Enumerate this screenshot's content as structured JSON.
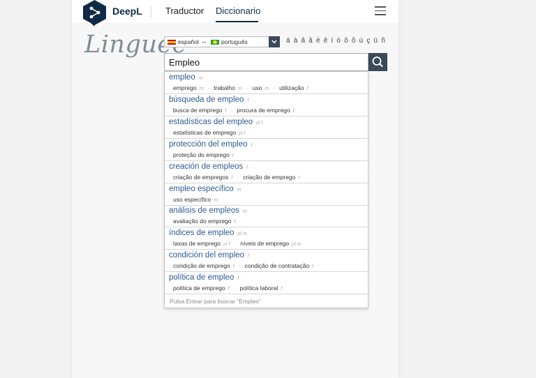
{
  "header": {
    "brand": "DeepL",
    "nav": [
      {
        "label": "Traductor"
      },
      {
        "label": "Diccionario"
      }
    ]
  },
  "linguee_logo": "Linguee",
  "language_selector": {
    "source": "español",
    "target": "português",
    "arrow": "↔"
  },
  "accent_chars": "á à ã â é ê í ó õ ô ú ç ü ñ",
  "search": {
    "value": "Empleo"
  },
  "suggestions": [
    {
      "term": "empleo",
      "gender": "m",
      "translations": [
        {
          "text": "emprego",
          "g": "m"
        },
        {
          "text": "trabalho",
          "g": "m"
        },
        {
          "text": "uso",
          "g": "m"
        },
        {
          "text": "utilização",
          "g": "f"
        }
      ]
    },
    {
      "term": "búsqueda de empleo",
      "gender": "f",
      "translations": [
        {
          "text": "busca de emprego",
          "g": "f"
        },
        {
          "text": "procura de emprego",
          "g": "f"
        }
      ]
    },
    {
      "term": "estadísticas del empleo",
      "gender": "pl f",
      "translations": [
        {
          "text": "estatísticas de emprego",
          "g": "pl f"
        }
      ]
    },
    {
      "term": "protección del empleo",
      "gender": "f",
      "translations": [
        {
          "text": "proteção do emprego",
          "g": "f"
        }
      ]
    },
    {
      "term": "creación de empleos",
      "gender": "f",
      "translations": [
        {
          "text": "criação de empregos",
          "g": "f"
        },
        {
          "text": "criação de emprego",
          "g": "f"
        }
      ]
    },
    {
      "term": "empleo específico",
      "gender": "m",
      "translations": [
        {
          "text": "uso específico",
          "g": "m"
        }
      ]
    },
    {
      "term": "análisis de empleos",
      "gender": "m",
      "translations": [
        {
          "text": "avaliação do emprego",
          "g": "f"
        }
      ]
    },
    {
      "term": "índices de empleo",
      "gender": "pl m",
      "translations": [
        {
          "text": "taxas de emprego",
          "g": "pl f"
        },
        {
          "text": "níveis de emprego",
          "g": "pl m"
        }
      ]
    },
    {
      "term": "condición del empleo",
      "gender": "f",
      "translations": [
        {
          "text": "condição de emprego",
          "g": "f"
        },
        {
          "text": "condição de contratação",
          "g": "f"
        }
      ]
    },
    {
      "term": "política de empleo",
      "gender": "f",
      "translations": [
        {
          "text": "política de emprego",
          "g": "f"
        },
        {
          "text": "política laboral",
          "g": "f"
        }
      ]
    }
  ],
  "footer_hint": "Pulsa Entrar para buscar “Empleo”",
  "icons": {
    "logo": "deepl-logo-icon",
    "menu": "hamburger-menu-icon",
    "search": "search-icon",
    "dropdown": "chevron-down-icon"
  },
  "colors": {
    "brand": "#0f2b46",
    "link": "#2c5b91",
    "button": "#3b4a5a"
  }
}
